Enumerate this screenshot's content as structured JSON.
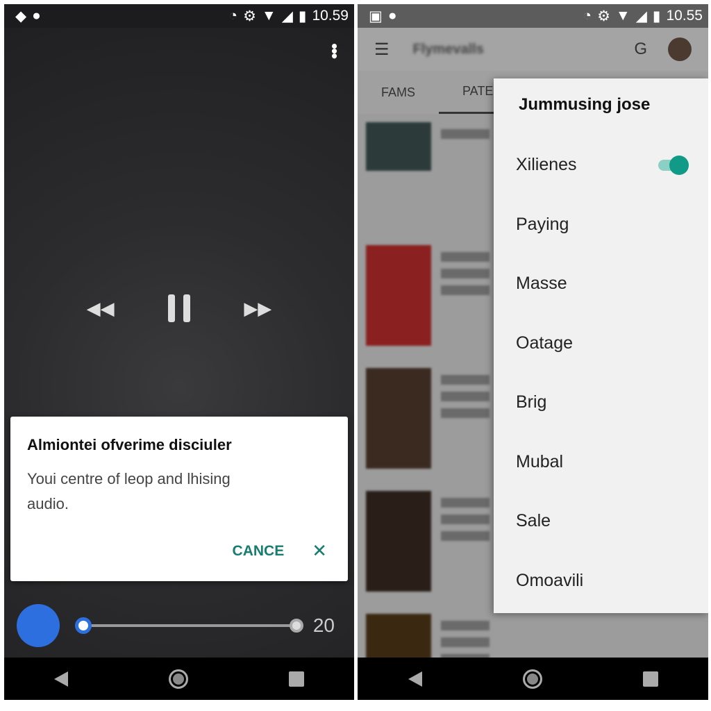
{
  "left": {
    "status": {
      "time": "10.59",
      "icons": [
        "wifi-lock-icon",
        "account-icon",
        "alarm-icon",
        "gear-icon",
        "wifi-icon",
        "signal-icon",
        "signal-icon",
        "battery-icon"
      ]
    },
    "dialog": {
      "title": "Almiontei ofverime disciuler",
      "body": "Youi centre of leop and lhising audio.",
      "cancel": "CANCE",
      "close_icon": "✕",
      "accent": "#167d6f"
    },
    "player": {
      "count": "20",
      "progress": 0,
      "fab_color": "#2e6fe0"
    }
  },
  "right": {
    "status": {
      "time": "10.55"
    },
    "appbar": {
      "title": "Flymevalls"
    },
    "tabs": [
      "FAMS",
      "PATE"
    ],
    "menu": {
      "title": "Jummusing jose",
      "items": [
        {
          "label": "Xilienes",
          "toggle": true
        },
        {
          "label": "Paying"
        },
        {
          "label": "Masse"
        },
        {
          "label": "Oatage"
        },
        {
          "label": "Brig"
        },
        {
          "label": "Mubal"
        },
        {
          "label": "Sale"
        },
        {
          "label": "Omoavili"
        }
      ],
      "toggle_color": "#129a88"
    }
  }
}
